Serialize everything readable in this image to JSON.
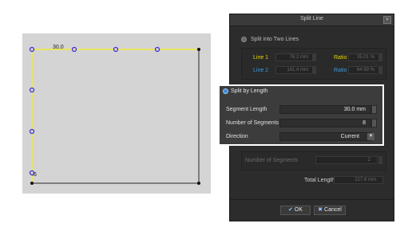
{
  "canvas": {
    "dimension_label": "30.0",
    "corner_label": ".6"
  },
  "dialog": {
    "title": "Split Line",
    "close_glyph": "×",
    "option_two_lines": "Split into Two Lines",
    "line1_label": "Line 1",
    "line1_value": "76.2 mm",
    "ratio1_label": "Ratio",
    "ratio1_value": "35.01 %",
    "line2_label": "Line 2",
    "line2_value": "141.4 mm",
    "ratio2_label": "Ratio",
    "ratio2_value": "64.99 %",
    "segments_label": "Number of Segments",
    "segments_value": "2",
    "total_length_label": "Total Length",
    "total_length_value": "217.6 mm",
    "ok_label": "OK",
    "cancel_label": "Cancel",
    "ok_icon": "check-icon",
    "cancel_icon": "x-icon"
  },
  "popup": {
    "title": "Split by Length",
    "segment_length_label": "Segment Length",
    "segment_length_value": "30.0 mm",
    "num_segments_label": "Number of Segments",
    "num_segments_value": "8",
    "direction_label": "Direction",
    "direction_value": "Current",
    "dropdown_glyph": "▼"
  },
  "colors": {
    "line1": "#e8d600",
    "line2": "#3b9ae0",
    "ratio": "#e8d600",
    "accent": "#3b8ad8",
    "path": "#f0e83a",
    "node": "#3a2ad0"
  }
}
